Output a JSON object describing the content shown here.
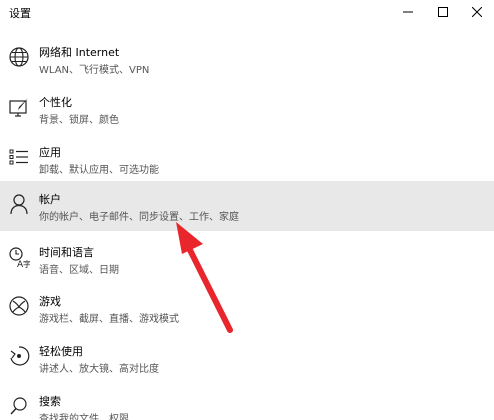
{
  "window": {
    "title": "设置",
    "min_symbol": "—",
    "max_symbol": "☐",
    "close_symbol": "✕"
  },
  "items": [
    {
      "title": "网络和 Internet",
      "desc": "WLAN、飞行模式、VPN",
      "icon": "globe-icon"
    },
    {
      "title": "个性化",
      "desc": "背景、锁屏、颜色",
      "icon": "personalization-icon"
    },
    {
      "title": "应用",
      "desc": "卸载、默认应用、可选功能",
      "icon": "apps-list-icon"
    },
    {
      "title": "帐户",
      "desc": "你的帐户、电子邮件、同步设置、工作、家庭",
      "icon": "person-icon"
    },
    {
      "title": "时间和语言",
      "desc": "语音、区域、日期",
      "icon": "time-language-icon"
    },
    {
      "title": "游戏",
      "desc": "游戏栏、截屏、直播、游戏模式",
      "icon": "xbox-icon"
    },
    {
      "title": "轻松使用",
      "desc": "讲述人、放大镜、高对比度",
      "icon": "ease-of-access-icon"
    },
    {
      "title": "搜索",
      "desc": "查找我的文件、权限",
      "icon": "search-icon"
    }
  ],
  "colors": {
    "highlight": "#e8e8e8",
    "arrow": "#e8262b"
  }
}
